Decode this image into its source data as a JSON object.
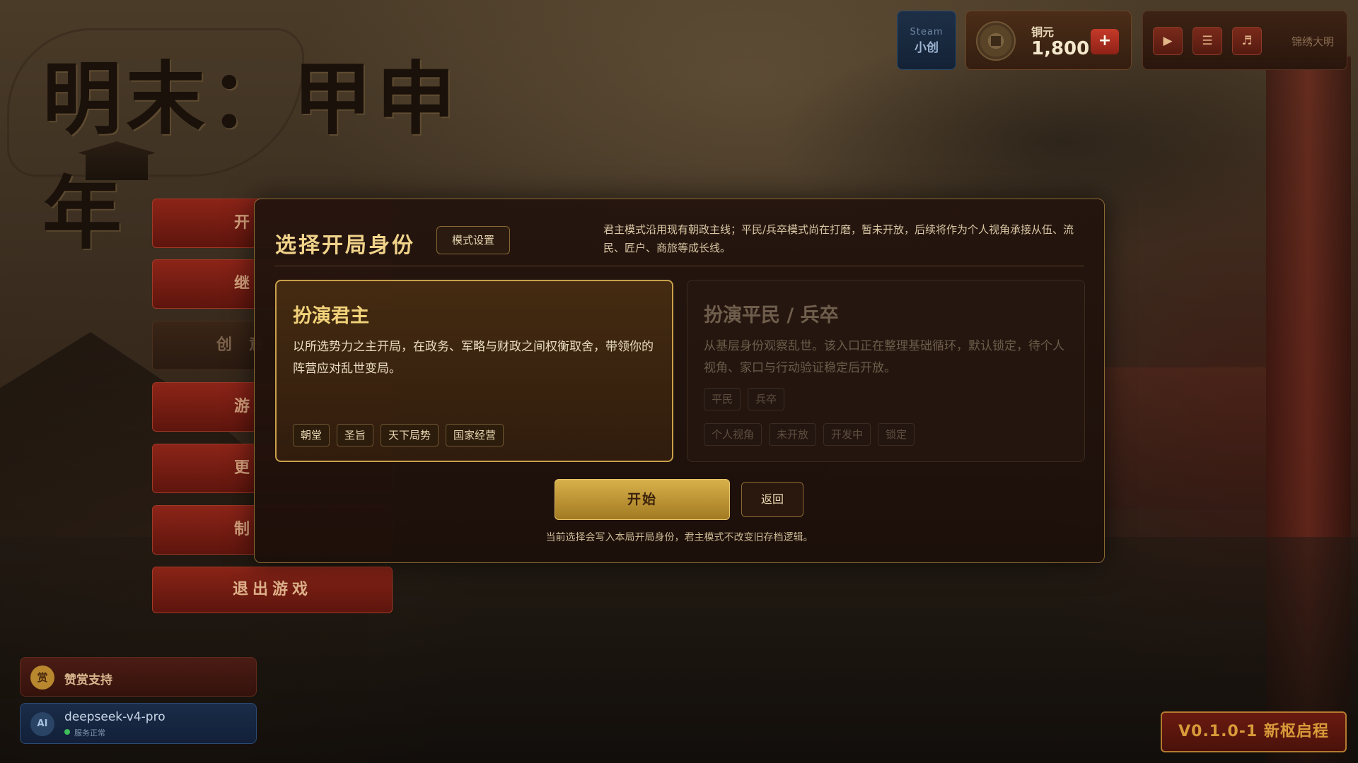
{
  "game": {
    "title": "明末：甲申年"
  },
  "hud": {
    "steam_line1": "Steam",
    "steam_line2": "小创",
    "coin_label": "铜元",
    "coin_value": "1,800",
    "coin_add": "+",
    "play_icon": "▶",
    "list_icon": "☰",
    "music_icon": "♬",
    "track_name": "锦绣大明"
  },
  "menu": {
    "items": [
      {
        "label": "开",
        "state": "active"
      },
      {
        "label": "继",
        "state": "active"
      },
      {
        "label": "创 意",
        "state": "dim"
      },
      {
        "label": "游",
        "state": "active"
      },
      {
        "label": "更",
        "state": "active"
      },
      {
        "label": "制",
        "state": "active"
      }
    ],
    "exit_label": "退出游戏"
  },
  "support": {
    "icon_text": "赏",
    "label": "赞赏支持"
  },
  "model": {
    "icon_text": "AI",
    "name": "deepseek-v4-pro",
    "status": "服务正常",
    "status_color": "#3fbf5a"
  },
  "version": "V0.1.0-1 新枢启程",
  "modal": {
    "title": "选择开局身份",
    "mode_settings": "模式设置",
    "note": "君主模式沿用现有朝政主线；平民/兵卒模式尚在打磨，暂未开放，后续将作为个人视角承接从伍、流民、匠户、商旅等成长线。",
    "cards": [
      {
        "title": "扮演君主",
        "desc": "以所选势力之主开局，在政务、军略与财政之间权衡取舍，带领你的阵营应对乱世变局。",
        "selected": true,
        "tags_row1": [],
        "tags_row2": [
          "朝堂",
          "圣旨",
          "天下局势",
          "国家经营"
        ]
      },
      {
        "title": "扮演平民 / 兵卒",
        "desc": "从基层身份观察乱世。该入口正在整理基础循环，默认锁定，待个人视角、家口与行动验证稳定后开放。",
        "selected": false,
        "tags_row1": [
          "平民",
          "兵卒"
        ],
        "tags_row2": [
          "个人视角",
          "未开放",
          "开发中",
          "锁定"
        ]
      }
    ],
    "start_label": "开始",
    "back_label": "返回",
    "footer": "当前选择会写入本局开局身份，君主模式不改变旧存档逻辑。"
  },
  "colors": {
    "accent_gold": "#d8b04a",
    "menu_red": "#8c2418",
    "modal_border": "#8a6a32"
  }
}
